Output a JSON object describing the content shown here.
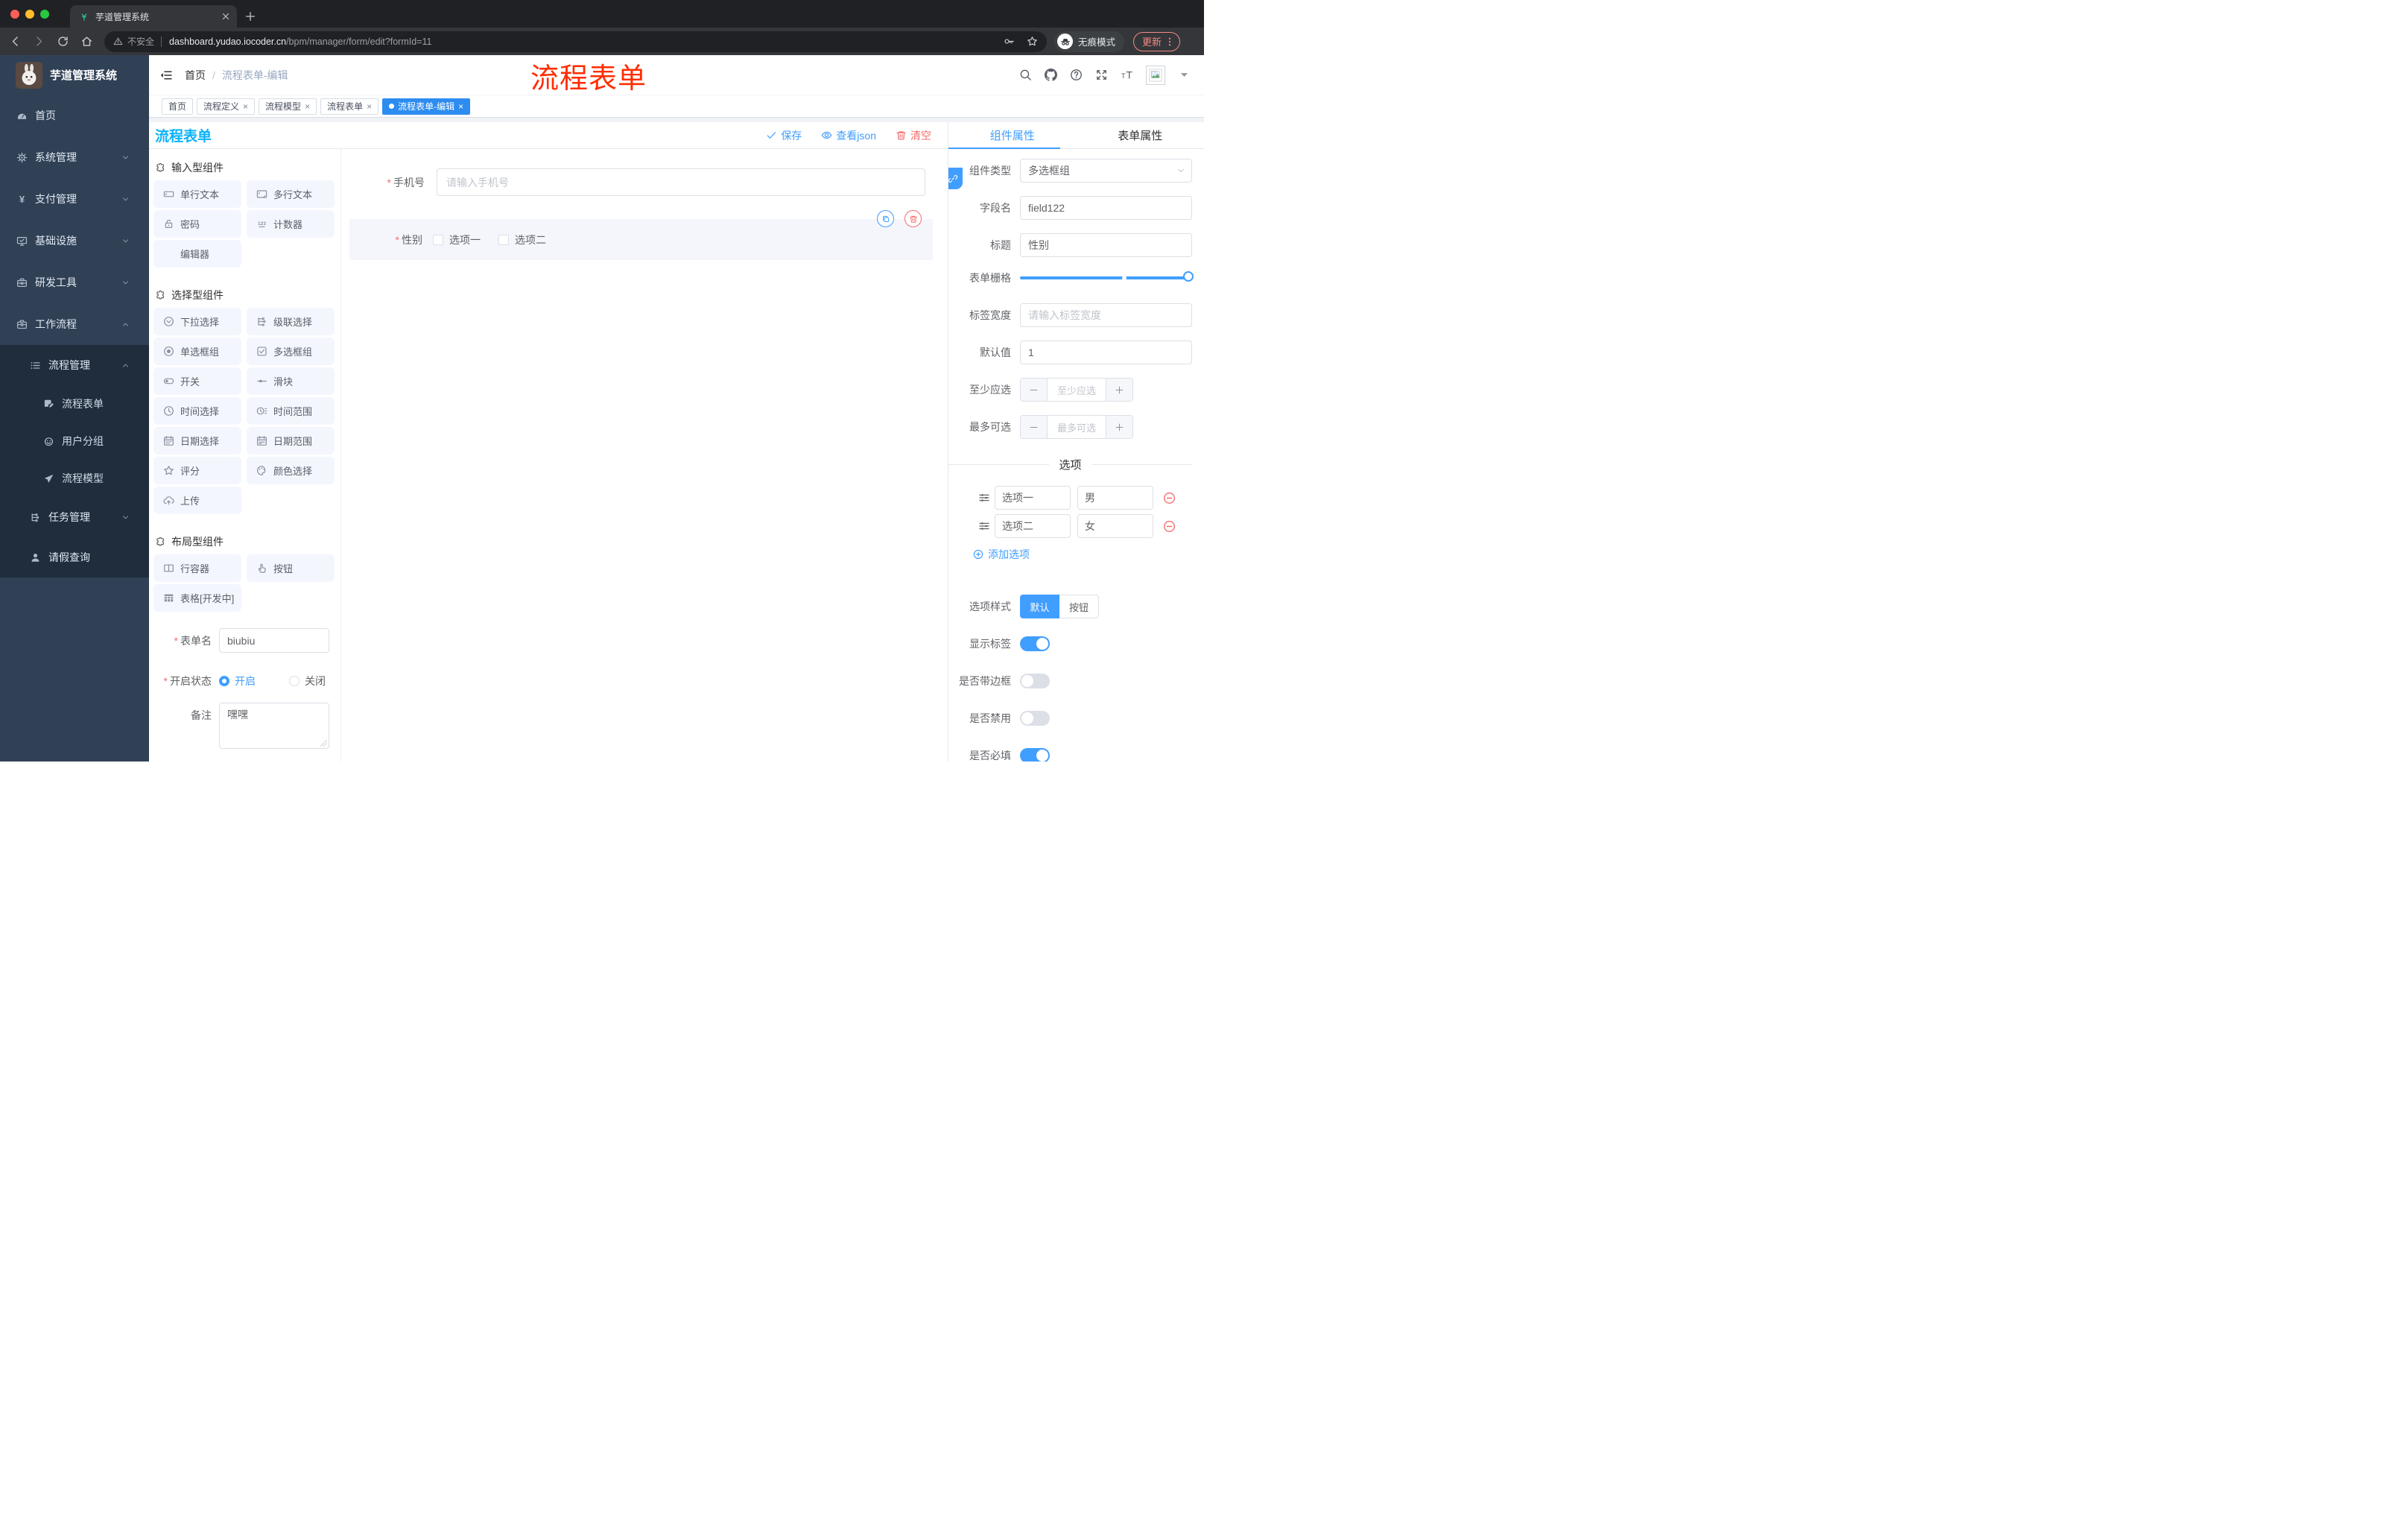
{
  "browser": {
    "tab_title": "芋道管理系统",
    "security_label": "不安全",
    "url_host": "dashboard.yudao.iocoder.cn",
    "url_path": "/bpm/manager/form/edit?formId=11",
    "incognito_label": "无痕模式",
    "update_label": "更新"
  },
  "annotation": {
    "text": "流程表单"
  },
  "sidebar": {
    "app_title": "芋道管理系统",
    "items": [
      {
        "label": "首页",
        "icon": "dashboard-icon",
        "level": 1
      },
      {
        "label": "系统管理",
        "icon": "gear-icon",
        "level": 1,
        "chevron": "down"
      },
      {
        "label": "支付管理",
        "icon": "yen-icon",
        "level": 1,
        "chevron": "down"
      },
      {
        "label": "基础设施",
        "icon": "monitor-icon",
        "level": 1,
        "chevron": "down"
      },
      {
        "label": "研发工具",
        "icon": "toolbox-icon",
        "level": 1,
        "chevron": "down"
      },
      {
        "label": "工作流程",
        "icon": "briefcase-icon",
        "level": 1,
        "chevron": "up"
      },
      {
        "label": "流程管理",
        "icon": "list-tree-icon",
        "level": 2,
        "chevron": "up"
      },
      {
        "label": "流程表单",
        "icon": "form-doc-icon",
        "level": 3
      },
      {
        "label": "用户分组",
        "icon": "face-icon",
        "level": 3
      },
      {
        "label": "流程模型",
        "icon": "paper-plane-icon",
        "level": 3
      },
      {
        "label": "任务管理",
        "icon": "tree-icon",
        "level": 2,
        "chevron": "down"
      },
      {
        "label": "请假查询",
        "icon": "person-icon",
        "level": 2
      }
    ]
  },
  "header": {
    "breadcrumb": [
      "首页",
      "流程表单-编辑"
    ],
    "separator": "/"
  },
  "tabbar": {
    "close_glyph": "×",
    "tabs": [
      {
        "label": "首页",
        "closable": false,
        "active": false
      },
      {
        "label": "流程定义",
        "closable": true,
        "active": false
      },
      {
        "label": "流程模型",
        "closable": true,
        "active": false
      },
      {
        "label": "流程表单",
        "closable": true,
        "active": false
      },
      {
        "label": "流程表单-编辑",
        "closable": true,
        "active": true
      }
    ]
  },
  "designer": {
    "title": "流程表单",
    "toolbar": [
      {
        "label": "保存",
        "icon": "check-icon",
        "style": "blue"
      },
      {
        "label": "查看json",
        "icon": "eye-icon",
        "style": "blue"
      },
      {
        "label": "清空",
        "icon": "trash-icon",
        "style": "red"
      }
    ],
    "palette": {
      "sections": [
        {
          "title": "输入型组件",
          "icon": "puzzle-icon",
          "items": [
            {
              "label": "单行文本",
              "icon": "input-icon"
            },
            {
              "label": "多行文本",
              "icon": "textarea-icon"
            },
            {
              "label": "密码",
              "icon": "lock-icon"
            },
            {
              "label": "计数器",
              "icon": "counter-icon"
            },
            {
              "label": "编辑器",
              "icon": ""
            }
          ]
        },
        {
          "title": "选择型组件",
          "icon": "puzzle-icon",
          "items": [
            {
              "label": "下拉选择",
              "icon": "select-icon"
            },
            {
              "label": "级联选择",
              "icon": "cascader-icon"
            },
            {
              "label": "单选框组",
              "icon": "radio-icon"
            },
            {
              "label": "多选框组",
              "icon": "checkbox-icon"
            },
            {
              "label": "开关",
              "icon": "switch-icon"
            },
            {
              "label": "滑块",
              "icon": "slider-icon"
            },
            {
              "label": "时间选择",
              "icon": "clock-icon"
            },
            {
              "label": "时间范围",
              "icon": "time-range-icon"
            },
            {
              "label": "日期选择",
              "icon": "calendar-icon"
            },
            {
              "label": "日期范围",
              "icon": "calendar-range-icon"
            },
            {
              "label": "评分",
              "icon": "star-icon"
            },
            {
              "label": "颜色选择",
              "icon": "palette-icon"
            },
            {
              "label": "上传",
              "icon": "upload-icon"
            }
          ]
        },
        {
          "title": "布局型组件",
          "icon": "puzzle-icon",
          "items": [
            {
              "label": "行容器",
              "icon": "columns-icon"
            },
            {
              "label": "按钮",
              "icon": "pointer-icon"
            },
            {
              "label": "表格[开发中]",
              "icon": "table-icon"
            }
          ]
        }
      ]
    },
    "meta_form": {
      "form_name": {
        "label": "表单名",
        "required": true,
        "value": "biubiu"
      },
      "status": {
        "label": "开启状态",
        "required": true,
        "options": [
          "开启",
          "关闭"
        ],
        "selected": "开启"
      },
      "remark": {
        "label": "备注",
        "value": "嘿嘿"
      }
    },
    "canvas": {
      "phone": {
        "label": "手机号",
        "required": true,
        "placeholder": "请输入手机号"
      },
      "gender": {
        "label": "性别",
        "required": true,
        "options": [
          "选项一",
          "选项二"
        ]
      }
    }
  },
  "props_panel": {
    "tabs": [
      {
        "label": "组件属性",
        "active": true
      },
      {
        "label": "表单属性",
        "active": false
      }
    ],
    "fields": {
      "component_type": {
        "label": "组件类型",
        "value": "多选框组"
      },
      "field_name": {
        "label": "字段名",
        "value": "field122"
      },
      "title": {
        "label": "标题",
        "value": "性别"
      },
      "grid": {
        "label": "表单栅格"
      },
      "label_width": {
        "label": "标签宽度",
        "placeholder": "请输入标签宽度"
      },
      "default_value": {
        "label": "默认值",
        "value": "1"
      },
      "min_checked": {
        "label": "至少应选",
        "placeholder": "至少应选"
      },
      "max_checked": {
        "label": "最多可选",
        "placeholder": "最多可选"
      }
    },
    "options_section": {
      "divider_label": "选项",
      "rows": [
        {
          "label": "选项一",
          "value": "男"
        },
        {
          "label": "选项二",
          "value": "女"
        }
      ],
      "add_label": "添加选项"
    },
    "style_section": {
      "option_style": {
        "label": "选项样式",
        "options": [
          "默认",
          "按钮"
        ],
        "selected": "默认"
      },
      "toggles": [
        {
          "label": "显示标签",
          "on": true
        },
        {
          "label": "是否带边框",
          "on": false
        },
        {
          "label": "是否禁用",
          "on": false
        },
        {
          "label": "是否必填",
          "on": true
        }
      ]
    }
  },
  "colors": {
    "accent": "#409eff",
    "title_blue": "#0ab2fb",
    "danger": "#f56c6c",
    "annotation": "#ff2d00",
    "active_tab": "#2d8cf0"
  }
}
